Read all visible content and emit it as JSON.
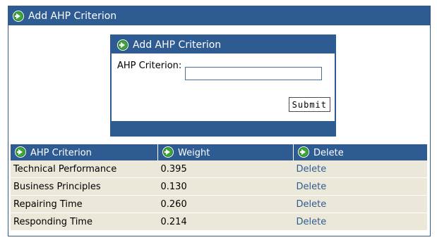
{
  "outer_panel": {
    "title": "Add AHP Criterion"
  },
  "form_panel": {
    "title": "Add AHP Criterion",
    "criterion_label": "AHP Criterion:",
    "criterion_value": "",
    "submit_label": "Submit"
  },
  "table": {
    "headers": [
      "AHP Criterion",
      "Weight",
      "Delete"
    ],
    "rows": [
      {
        "criterion": "Technical Performance",
        "weight": "0.395",
        "action": "Delete"
      },
      {
        "criterion": "Business Principles",
        "weight": "0.130",
        "action": "Delete"
      },
      {
        "criterion": "Repairing Time",
        "weight": "0.260",
        "action": "Delete"
      },
      {
        "criterion": "Responding Time",
        "weight": "0.214",
        "action": "Delete"
      }
    ]
  },
  "colors": {
    "header_blue": "#2e5c92",
    "row_bg": "#ebe8da",
    "icon_green": "#3fa33f",
    "link_blue": "#2e5c92"
  },
  "icons": {
    "header_icon": "green-arrow-icon"
  }
}
